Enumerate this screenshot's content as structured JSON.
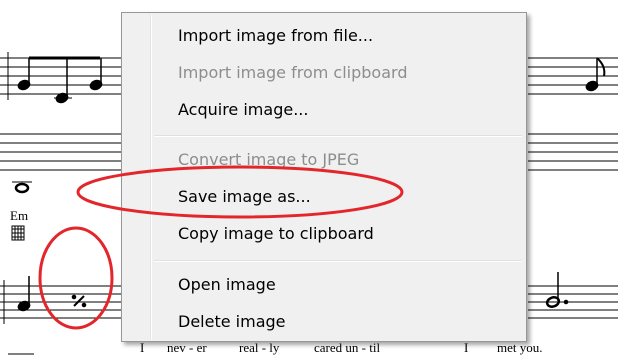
{
  "score": {
    "chord_symbol": "Em",
    "lyrics": [
      {
        "text": "I"
      },
      {
        "text": "nev - er"
      },
      {
        "text": "real - ly"
      },
      {
        "text": "cared  un - til"
      },
      {
        "text": "I"
      },
      {
        "text": "met  you."
      }
    ]
  },
  "context_menu": {
    "items": [
      {
        "label": "Import image from file...",
        "enabled": true
      },
      {
        "label": "Import image from clipboard",
        "enabled": false
      },
      {
        "label": "Acquire image...",
        "enabled": true
      },
      {
        "label": "Convert image to JPEG",
        "enabled": false
      },
      {
        "label": "Save image as...",
        "enabled": true
      },
      {
        "label": "Copy image to clipboard",
        "enabled": true
      },
      {
        "label": "Open image",
        "enabled": true
      },
      {
        "label": "Delete image",
        "enabled": true
      }
    ]
  },
  "annotation_color": "#e3262b"
}
